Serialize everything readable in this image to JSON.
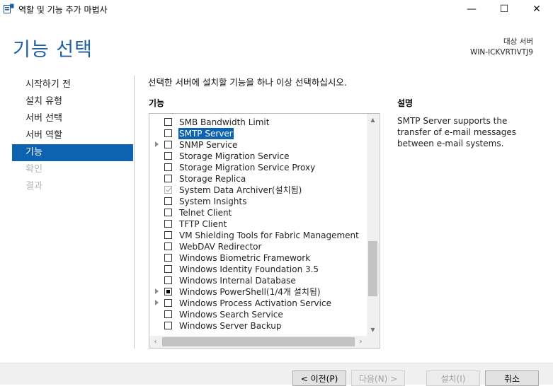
{
  "window": {
    "title": "역할 및 기능 추가 마법사",
    "app_icon": "server-manager-icon",
    "controls": {
      "minimize": "—",
      "maximize": "☐",
      "close": "✕"
    }
  },
  "header": {
    "page_title": "기능 선택",
    "target_label": "대상 서버",
    "target_server": "WIN-ICKVRTIVTJ9"
  },
  "nav": {
    "items": [
      {
        "label": "시작하기 전",
        "state": "normal"
      },
      {
        "label": "설치 유형",
        "state": "normal"
      },
      {
        "label": "서버 선택",
        "state": "normal"
      },
      {
        "label": "서버 역할",
        "state": "normal"
      },
      {
        "label": "기능",
        "state": "active"
      },
      {
        "label": "확인",
        "state": "disabled"
      },
      {
        "label": "결과",
        "state": "disabled"
      }
    ]
  },
  "main": {
    "instruction": "선택한 서버에 설치할 기능을 하나 이상 선택하십시오.",
    "features_label": "기능",
    "features": [
      {
        "label": "SMB Bandwidth Limit",
        "checkbox": "unchecked",
        "expandable": false,
        "selected": false
      },
      {
        "label": "SMTP Server",
        "checkbox": "unchecked",
        "expandable": false,
        "selected": true
      },
      {
        "label": "SNMP Service",
        "checkbox": "unchecked",
        "expandable": true,
        "selected": false
      },
      {
        "label": "Storage Migration Service",
        "checkbox": "unchecked",
        "expandable": false,
        "selected": false
      },
      {
        "label": "Storage Migration Service Proxy",
        "checkbox": "unchecked",
        "expandable": false,
        "selected": false
      },
      {
        "label": "Storage Replica",
        "checkbox": "unchecked",
        "expandable": false,
        "selected": false
      },
      {
        "label": "System Data Archiver(설치됨)",
        "checkbox": "checked-disabled",
        "expandable": false,
        "selected": false
      },
      {
        "label": "System Insights",
        "checkbox": "unchecked",
        "expandable": false,
        "selected": false
      },
      {
        "label": "Telnet Client",
        "checkbox": "unchecked",
        "expandable": false,
        "selected": false
      },
      {
        "label": "TFTP Client",
        "checkbox": "unchecked",
        "expandable": false,
        "selected": false
      },
      {
        "label": "VM Shielding Tools for Fabric Management",
        "checkbox": "unchecked",
        "expandable": false,
        "selected": false
      },
      {
        "label": "WebDAV Redirector",
        "checkbox": "unchecked",
        "expandable": false,
        "selected": false
      },
      {
        "label": "Windows Biometric Framework",
        "checkbox": "unchecked",
        "expandable": false,
        "selected": false
      },
      {
        "label": "Windows Identity Foundation 3.5",
        "checkbox": "unchecked",
        "expandable": false,
        "selected": false
      },
      {
        "label": "Windows Internal Database",
        "checkbox": "unchecked",
        "expandable": false,
        "selected": false
      },
      {
        "label": "Windows PowerShell(1/4개 설치됨)",
        "checkbox": "partial",
        "expandable": true,
        "selected": false
      },
      {
        "label": "Windows Process Activation Service",
        "checkbox": "unchecked",
        "expandable": true,
        "selected": false
      },
      {
        "label": "Windows Search Service",
        "checkbox": "unchecked",
        "expandable": false,
        "selected": false
      },
      {
        "label": "Windows Server Backup",
        "checkbox": "unchecked",
        "expandable": false,
        "selected": false
      }
    ],
    "description_label": "설명",
    "description_text": "SMTP Server supports the transfer of e-mail messages between e-mail systems."
  },
  "footer": {
    "buttons": [
      {
        "label": "< 이전(P)",
        "enabled": true,
        "name": "previous-button"
      },
      {
        "label": "다음(N) >",
        "enabled": false,
        "name": "next-button"
      },
      {
        "label": "설치(I)",
        "enabled": false,
        "name": "install-button"
      },
      {
        "label": "취소",
        "enabled": true,
        "name": "cancel-button"
      }
    ]
  },
  "colors": {
    "accent": "#0e63b0",
    "title": "#1f5fa6"
  }
}
